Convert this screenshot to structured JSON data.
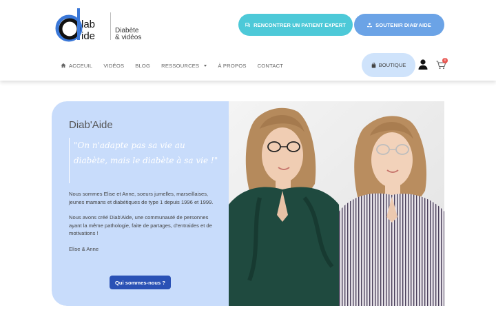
{
  "brand": {
    "logo_text": "Diab Aide",
    "tagline_line1": "Diabète",
    "tagline_line2": "& vidéos"
  },
  "header": {
    "cta_expert_label": "RENCONTRER UN PATIENT EXPERT",
    "cta_support_label": "SOUTENIR DIAB'AIDE",
    "nav": [
      {
        "label": "ACCEUIL",
        "icon": "home-icon"
      },
      {
        "label": "VIDÉOS"
      },
      {
        "label": "BLOG"
      },
      {
        "label": "RESSOURCES",
        "icon": "caret-down-icon"
      },
      {
        "label": "À PROPOS"
      },
      {
        "label": "CONTACT"
      }
    ],
    "shop_label": "BOUTIQUE",
    "cart_count": "0"
  },
  "hero": {
    "title": "Diab'Aide",
    "quote": "\"On n'adapte pas sa vie au diabète, mais le diabète à sa vie !\"",
    "paragraph1": "Nous sommes Elise et Anne, soeurs jumelles, marseillaises, jeunes mamans et diabétiques de type 1 depuis 1996 et 1999.",
    "paragraph2": "Nous avons créé Diab'Aide, une communauté de personnes ayant la même pathologie, faite de partages, d'entraides et de motivations !",
    "signature": "Elise & Anne",
    "button_label": "Qui sommes-nous ?"
  },
  "colors": {
    "cta_expert": "#4dc9d8",
    "cta_support": "#6ba3e6",
    "hero_panel": "#c8dcfb",
    "primary_button": "#2a51b5",
    "badge": "#e8544f"
  }
}
